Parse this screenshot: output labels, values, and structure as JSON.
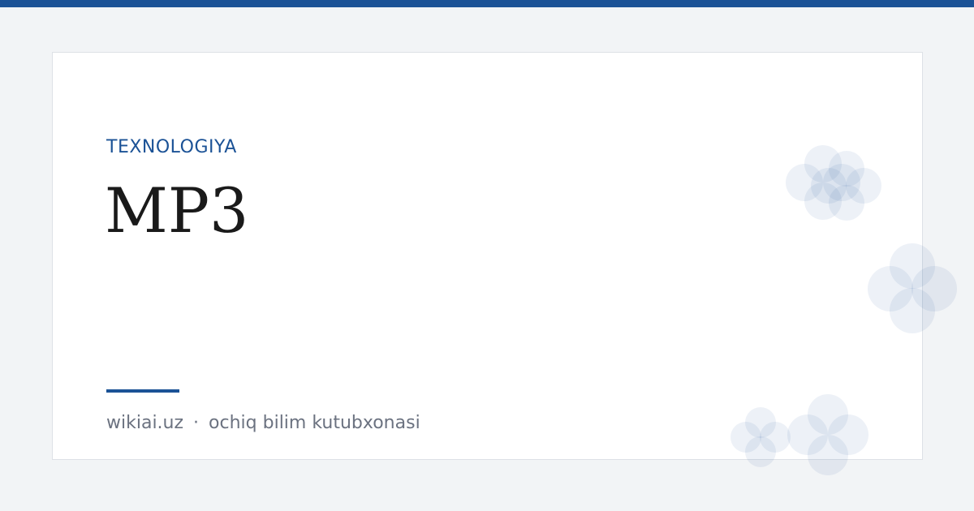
{
  "accent_color": "#1b5296",
  "category": "TEXNOLOGIYA",
  "title": "MP3",
  "footer": {
    "site": "wikiai.uz",
    "separator": "·",
    "tagline": "ochiq bilim kutubxonasi"
  },
  "decoration_icon": "flower-pattern-icon"
}
